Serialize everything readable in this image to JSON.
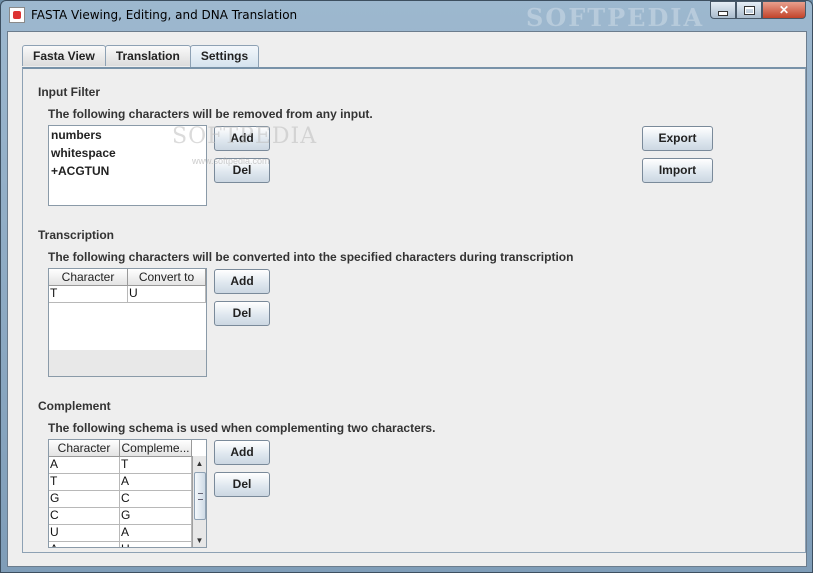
{
  "window": {
    "title": "FASTA Viewing, Editing, and DNA Translation",
    "watermark": "SOFTPEDIA",
    "buttons": {
      "minimize": "minimize-icon",
      "maximize": "maximize-icon",
      "close": "close-icon"
    },
    "close_glyph": "✕"
  },
  "tabs": [
    {
      "label": "Fasta View"
    },
    {
      "label": "Translation"
    },
    {
      "label": "Settings",
      "active": true
    }
  ],
  "input_filter": {
    "heading": "Input Filter",
    "description": "The following characters will be removed from any input.",
    "items": [
      "numbers",
      "whitespace",
      "+ACGTUN"
    ],
    "add_label": "Add",
    "del_label": "Del",
    "export_label": "Export",
    "import_label": "Import"
  },
  "content_watermark": {
    "text": "SOFTPEDIA",
    "subtext": "www.softpedia.com"
  },
  "transcription": {
    "heading": "Transcription",
    "description": "The following characters will be converted into the specified characters during transcription",
    "columns": [
      "Character",
      "Convert to"
    ],
    "rows": [
      [
        "T",
        "U"
      ]
    ],
    "add_label": "Add",
    "del_label": "Del"
  },
  "complement": {
    "heading": "Complement",
    "description": "The following schema is used when complementing two characters.",
    "columns": [
      "Character",
      "Compleme..."
    ],
    "rows": [
      [
        "A",
        "T"
      ],
      [
        "T",
        "A"
      ],
      [
        "G",
        "C"
      ],
      [
        "C",
        "G"
      ],
      [
        "U",
        "A"
      ],
      [
        "A",
        "U"
      ]
    ],
    "add_label": "Add",
    "del_label": "Del",
    "scroll_up": "▲",
    "scroll_down": "▼"
  },
  "colors": {
    "titlebar": "#9db8cf",
    "panel_bg": "#eeeeee",
    "tab_border": "#8da1b4",
    "close_button": "#c2432a"
  }
}
